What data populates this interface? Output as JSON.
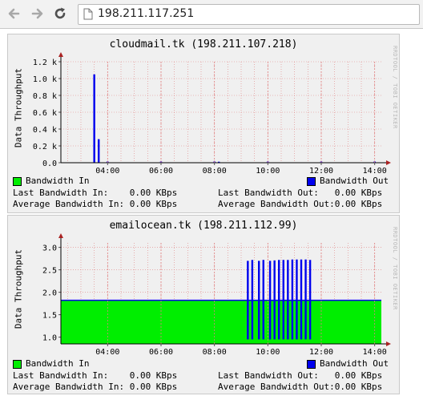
{
  "browser": {
    "url": "198.211.117.251",
    "back_icon": "back-arrow-icon",
    "forward_icon": "forward-arrow-icon",
    "reload_icon": "reload-icon",
    "page_icon": "page-icon"
  },
  "panels": [
    {
      "title": "cloudmail.tk (198.211.107.218)",
      "ylabel": "Data Throughput",
      "credit": "RRDTOOL / TOBI OETIKER",
      "legend": {
        "in_label": "Bandwidth In",
        "out_label": "Bandwidth Out",
        "last_in": "Last Bandwidth In:    0.00 KBps",
        "avg_in": "Average Bandwidth In: 0.00 KBps",
        "last_out": "Last Bandwidth Out:   0.00 KBps",
        "avg_out": "Average Bandwidth Out:0.00 KBps"
      }
    },
    {
      "title": "emailocean.tk (198.211.112.99)",
      "ylabel": "Data Throughput",
      "credit": "RRDTOOL / TOBI OETIKER",
      "legend": {
        "in_label": "Bandwidth In",
        "out_label": "Bandwidth Out",
        "last_in": "Last Bandwidth In:    0.00 KBps",
        "avg_in": "Average Bandwidth In: 0.00 KBps",
        "last_out": "Last Bandwidth Out:   0.00 KBps",
        "avg_out": "Average Bandwidth Out:0.00 KBps"
      }
    }
  ],
  "colors": {
    "in": "#00ee00",
    "out": "#0000ee",
    "grid": "#e08080",
    "axis": "#000000",
    "arrow": "#aa2222"
  },
  "chart_data": [
    {
      "type": "area",
      "title": "cloudmail.tk (198.211.107.218)",
      "xlabel": "",
      "ylabel": "Data Throughput",
      "x_ticks": [
        "04:00",
        "06:00",
        "08:00",
        "10:00",
        "12:00",
        "14:00"
      ],
      "y_ticks": [
        "0.0",
        "0.2 k",
        "0.4 k",
        "0.6 k",
        "0.8 k",
        "1.0 k",
        "1.2 k"
      ],
      "xlim": [
        "02:15",
        "14:15"
      ],
      "ylim": [
        0,
        1200
      ],
      "grid": true,
      "legend_position": "bottom",
      "series": [
        {
          "name": "Bandwidth In",
          "color": "#00ee00",
          "x": [],
          "values": []
        },
        {
          "name": "Bandwidth Out",
          "color": "#0000ee",
          "x": [
            "03:30",
            "03:40",
            "04:00",
            "06:00",
            "08:00",
            "08:10",
            "10:00",
            "12:00",
            "14:00"
          ],
          "values": [
            1050,
            280,
            15,
            15,
            15,
            12,
            15,
            15,
            15
          ]
        }
      ]
    },
    {
      "type": "area",
      "title": "emailocean.tk (198.211.112.99)",
      "xlabel": "",
      "ylabel": "Data Throughput",
      "x_ticks": [
        "04:00",
        "06:00",
        "08:00",
        "10:00",
        "12:00",
        "14:00"
      ],
      "y_ticks": [
        "1.0",
        "1.5",
        "2.0",
        "2.5",
        "3.0"
      ],
      "xlim": [
        "02:15",
        "14:15"
      ],
      "ylim": [
        0.85,
        3.1
      ],
      "grid": true,
      "legend_position": "bottom",
      "series": [
        {
          "name": "Bandwidth In",
          "color": "#00ee00",
          "x": [
            "02:15",
            "14:15"
          ],
          "values": [
            1.82,
            1.82
          ]
        },
        {
          "name": "Bandwidth Out",
          "color": "#0000ee",
          "x": [
            "09:15",
            "09:25",
            "09:40",
            "09:50",
            "10:05",
            "10:15",
            "10:25",
            "10:35",
            "10:45",
            "10:55",
            "11:05",
            "11:15",
            "11:25",
            "11:35"
          ],
          "values": [
            2.7,
            2.72,
            2.7,
            2.72,
            2.7,
            2.71,
            2.72,
            2.72,
            2.72,
            2.73,
            2.73,
            2.73,
            2.73,
            2.72
          ],
          "dips": [
            0.95,
            0.95,
            0.95,
            0.95,
            0.95,
            0.95,
            0.95,
            0.95,
            0.95,
            0.95,
            0.95,
            0.95,
            0.95,
            0.95
          ]
        }
      ]
    }
  ]
}
